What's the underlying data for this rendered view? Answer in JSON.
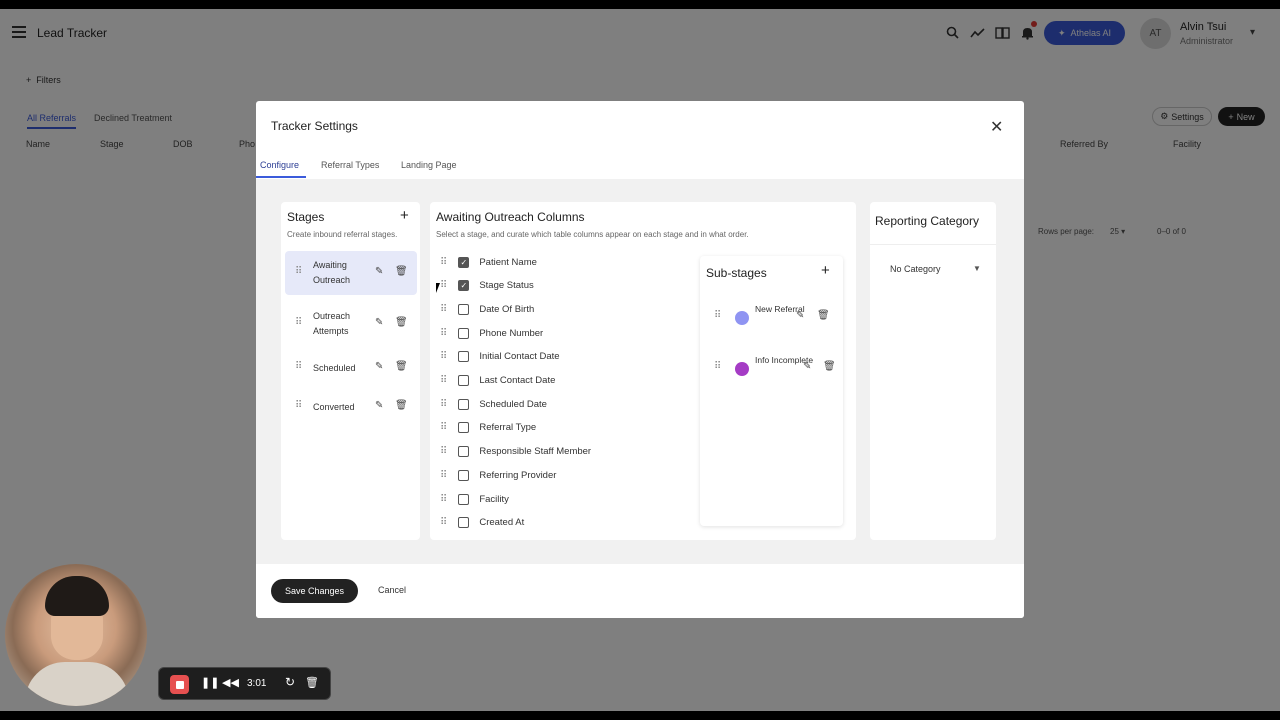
{
  "app": {
    "title": "Lead Tracker",
    "ai_label": "Athelas AI",
    "user_initials": "AT",
    "user_name": "Alvin Tsui",
    "user_role": "Administrator",
    "filters_label": "Filters",
    "tabs": [
      "All Referrals",
      "Declined Treatment"
    ],
    "settings_label": "Settings",
    "new_label": "New",
    "columns": [
      "Name",
      "Stage",
      "DOB",
      "Pho",
      "Referred By",
      "Facility"
    ],
    "rows_per_page_label": "Rows per page:",
    "rows_per_page_value": "25",
    "page_range": "0–0 of 0"
  },
  "modal": {
    "title": "Tracker Settings",
    "tabs": [
      "Configure",
      "Referral Types",
      "Landing Page"
    ],
    "stages_panel": {
      "title": "Stages",
      "subtitle": "Create inbound referral stages.",
      "items": [
        {
          "label": "Awaiting Outreach",
          "selected": true
        },
        {
          "label": "Outreach Attempts",
          "selected": false
        },
        {
          "label": "Scheduled",
          "selected": false
        },
        {
          "label": "Converted",
          "selected": false
        }
      ]
    },
    "columns_panel": {
      "title": "Awaiting Outreach Columns",
      "subtitle": "Select a stage, and curate which table columns appear on each stage and in what order.",
      "items": [
        {
          "label": "Patient Name",
          "checked": true
        },
        {
          "label": "Stage Status",
          "checked": true
        },
        {
          "label": "Date Of Birth",
          "checked": false
        },
        {
          "label": "Phone Number",
          "checked": false
        },
        {
          "label": "Initial Contact Date",
          "checked": false
        },
        {
          "label": "Last Contact Date",
          "checked": false
        },
        {
          "label": "Scheduled Date",
          "checked": false
        },
        {
          "label": "Referral Type",
          "checked": false
        },
        {
          "label": "Responsible Staff Member",
          "checked": false
        },
        {
          "label": "Referring Provider",
          "checked": false
        },
        {
          "label": "Facility",
          "checked": false
        },
        {
          "label": "Created At",
          "checked": false
        }
      ]
    },
    "substages_panel": {
      "title": "Sub-stages",
      "items": [
        {
          "label": "New Referral",
          "color": "#8f94f2"
        },
        {
          "label": "Info Incomplete",
          "color": "#a53cc5"
        }
      ]
    },
    "reporting_panel": {
      "title": "Reporting Category",
      "selected": "No Category"
    },
    "save_label": "Save Changes",
    "cancel_label": "Cancel"
  },
  "recorder": {
    "time": "3:01"
  },
  "icons": {
    "close": "close-icon",
    "plus": "plus-icon",
    "drag": "drag-handle-icon",
    "edit": "pencil-icon",
    "delete": "trash-icon"
  }
}
